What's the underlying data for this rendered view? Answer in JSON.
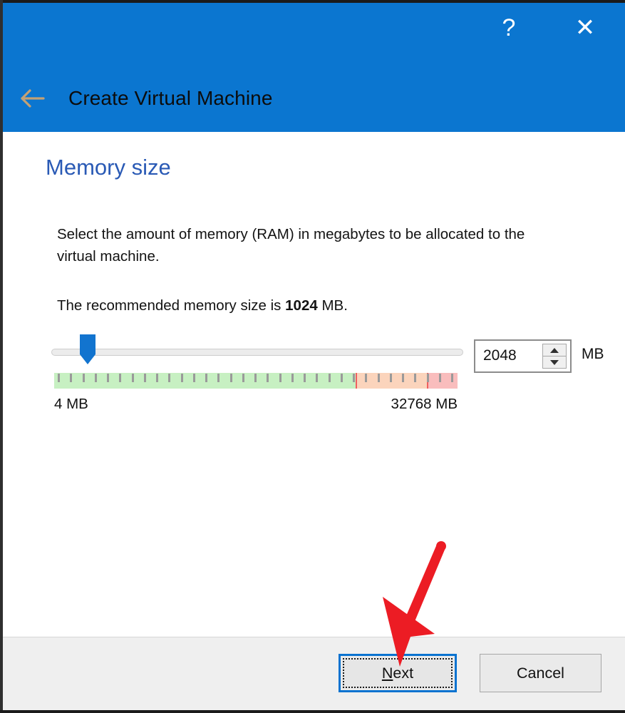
{
  "window": {
    "title": "Create Virtual Machine",
    "back_icon": "back-arrow-icon",
    "help_label": "?",
    "close_label": "✕",
    "header_color": "#0b76d0"
  },
  "page": {
    "heading": "Memory size",
    "heading_color": "#2a5ab5",
    "paragraph_1": "Select the amount of memory (RAM) in megabytes to be allocated to the virtual machine.",
    "paragraph_2_prefix": "The recommended memory size is ",
    "paragraph_2_value": "1024",
    "paragraph_2_suffix": " MB."
  },
  "memory_slider": {
    "min_label": "4 MB",
    "max_label": "32768 MB",
    "min_value": 4,
    "max_value": 32768,
    "current_value": 2048,
    "handle_position_percent": 7,
    "scale_segments": [
      {
        "name": "recommended-green",
        "color": "#c7f0c2",
        "width_percent": 74.7
      },
      {
        "name": "caution-orange",
        "color": "#fbd4bc",
        "width_percent": 17.7
      },
      {
        "name": "danger-red",
        "color": "#f9bdbd",
        "width_percent": 7.6
      }
    ],
    "tick_count": 33
  },
  "memory_spinbox": {
    "value": "2048",
    "unit_label": "MB",
    "increment_icon": "caret-up-icon",
    "decrement_icon": "caret-down-icon"
  },
  "footer": {
    "next_label_before": "N",
    "next_label_after": "ext",
    "next_label": "Next",
    "cancel_label": "Cancel",
    "focused_button": "Next"
  },
  "annotation": {
    "arrow_color": "#ec1c24",
    "points_to": "next-button"
  }
}
